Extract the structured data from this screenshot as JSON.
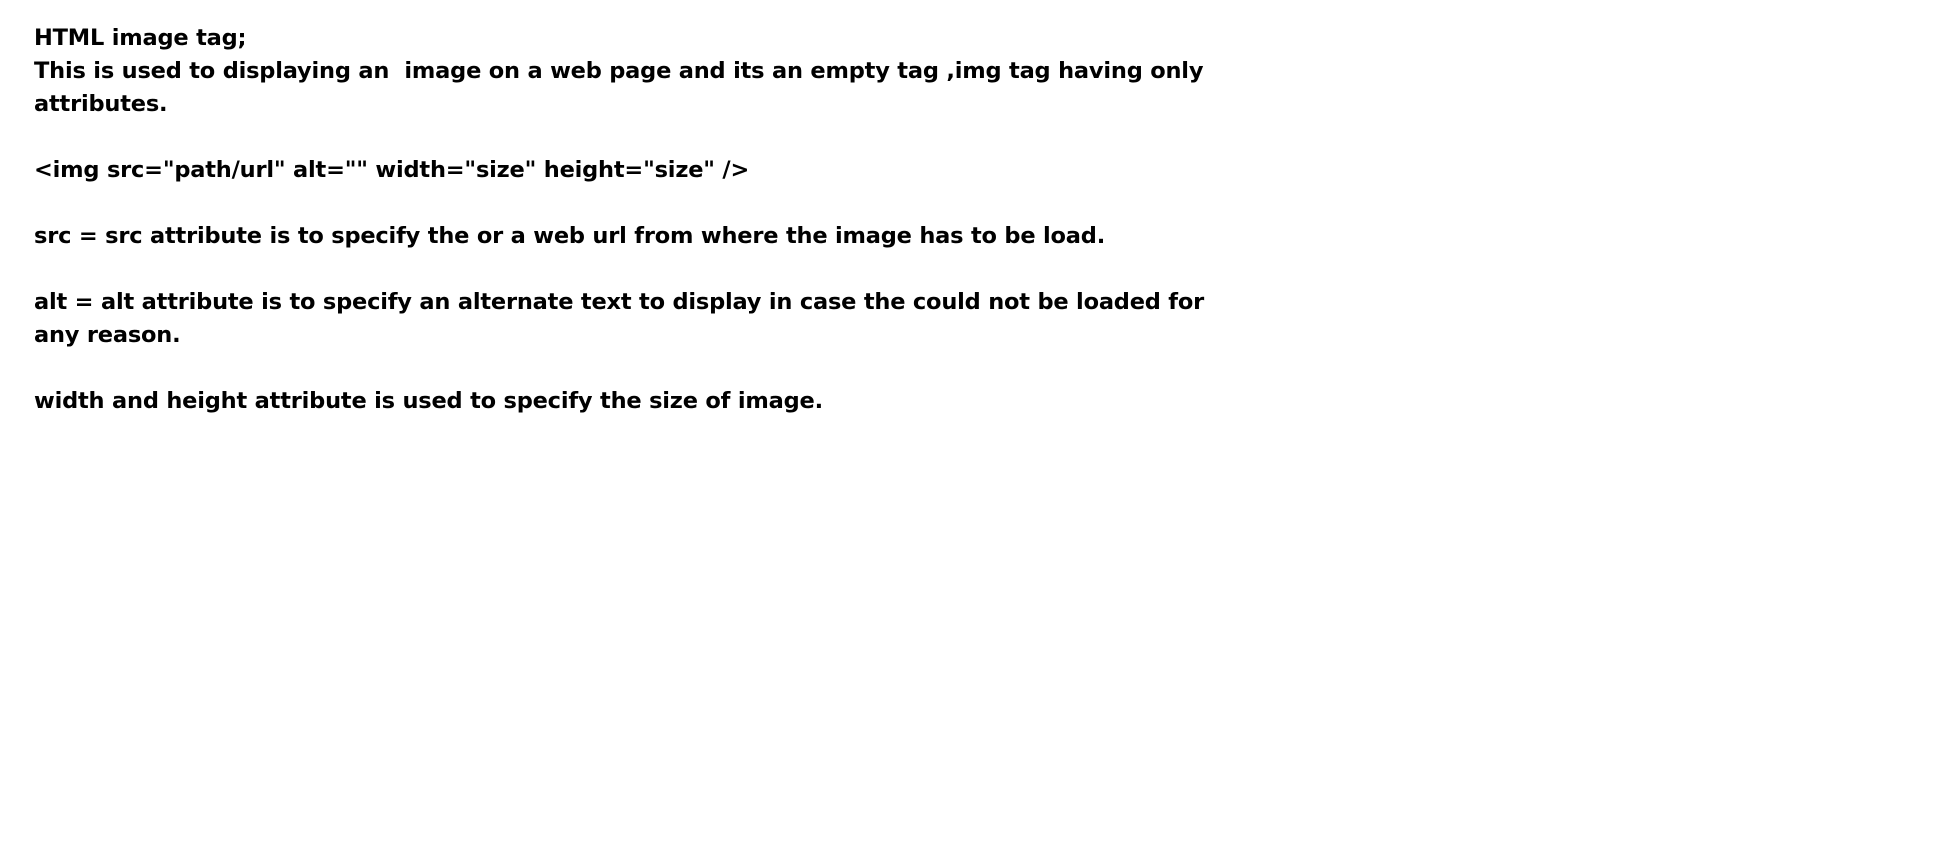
{
  "document": {
    "title": "HTML image tag;",
    "intro": [
      "This is used to displaying an  image on a web page and its an empty tag ,img tag having only",
      "attributes."
    ],
    "syntax": "<img src=\"path/url\" alt=\"\" width=\"size\" height=\"size\" />",
    "src_desc": "src = src attribute is to specify the or a web url from where the image has to be load.",
    "alt_desc": [
      "alt = alt attribute is to specify an alternate text to display in case the could not be loaded for",
      "any reason."
    ],
    "size_desc": "width and height attribute is used to specify the size of image."
  }
}
